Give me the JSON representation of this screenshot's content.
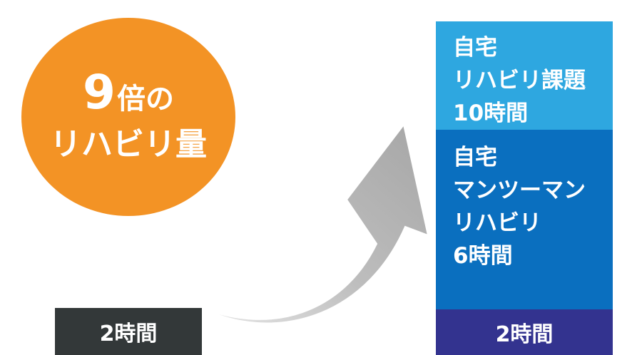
{
  "colors": {
    "circle": "#f39325",
    "left_bar": "#333839",
    "stack_top": "#2ea7e0",
    "stack_mid": "#0a6fbf",
    "stack_bottom": "#33338f",
    "arrow": "#b3b3b3"
  },
  "circle": {
    "number": "9",
    "suffix": "倍の",
    "line2": "リハビリ量"
  },
  "left_bar": {
    "label": "2時間"
  },
  "stack": {
    "top": {
      "line1": "自宅",
      "line2": "リハビリ課題",
      "line3": "10時間"
    },
    "middle": {
      "line1": "自宅",
      "line2": "マンツーマン",
      "line3": "リハビリ",
      "line4": "6時間"
    },
    "bottom": {
      "label": "2時間"
    }
  }
}
